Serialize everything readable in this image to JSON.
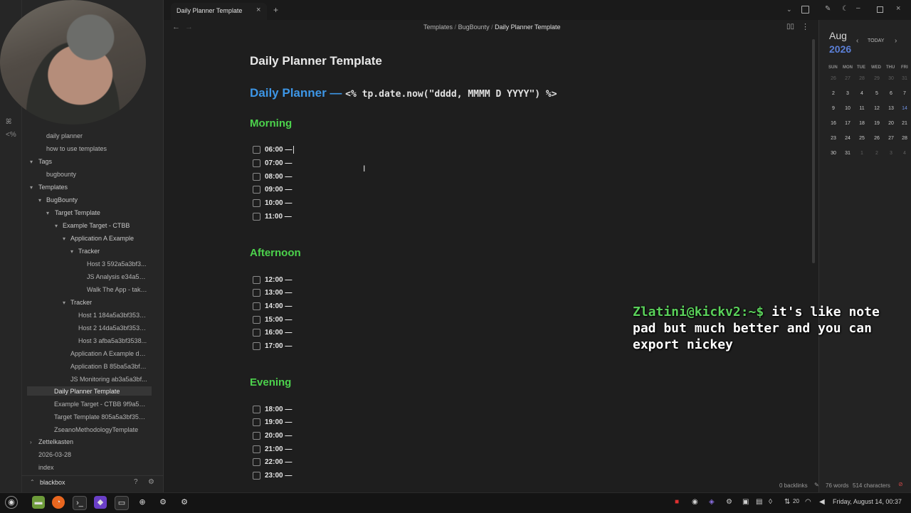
{
  "tab": {
    "title": "Daily Planner Template",
    "close": "×",
    "new": "+"
  },
  "breadcrumb": {
    "part1": "Templates",
    "sep": "/",
    "part2": "BugBounty",
    "part3": "Daily Planner Template"
  },
  "note": {
    "title": "Daily Planner Template",
    "heading_text": "Daily Planner — ",
    "heading_code": "<% tp.date.now(\"dddd, MMMM D YYYY\") %>",
    "sections": {
      "morning": "Morning",
      "afternoon": "Afternoon",
      "evening": "Evening"
    },
    "morning_tasks": [
      "06:00 —",
      "07:00 —",
      "08:00 —",
      "09:00 —",
      "10:00 —",
      "11:00 —"
    ],
    "afternoon_tasks": [
      "12:00 —",
      "13:00 —",
      "14:00 —",
      "15:00 —",
      "16:00 —",
      "17:00 —"
    ],
    "evening_tasks": [
      "18:00 —",
      "19:00 —",
      "20:00 —",
      "21:00 —",
      "22:00 —",
      "23:00 —"
    ]
  },
  "sidebar": {
    "items": [
      "daily planner",
      "how to use templates",
      "Tags",
      "bugbounty",
      "Templates",
      "BugBounty",
      "Target Template",
      "Example Target - CTBB",
      "Application A Example",
      "Tracker",
      "Host 3 592a5a3bf3...",
      "JS Analysis e34a5a...",
      "Walk The App - take...",
      "Tracker",
      "Host 1 184a5a3bf3538...",
      "Host 2 14da5a3bf3538...",
      "Host 3 afba5a3bf3538...",
      "Application A Example de...",
      "Application B 85ba5a3bf3...",
      "JS Monitoring ab3a5a3bf...",
      "Daily Planner Template",
      "Example Target - CTBB 9f9a5a...",
      "Target Template 805a5a3bf353...",
      "ZseanoMethodologyTemplate",
      "Zettelkasten",
      "2026-03-28",
      "index"
    ],
    "vault_name": "blackbox",
    "ribbon_icons": [
      "ꕤ",
      "<%"
    ]
  },
  "calendar": {
    "month": "Aug",
    "year": "2026",
    "today_button": "TODAY",
    "weekdays": [
      "SUN",
      "MON",
      "TUE",
      "WED",
      "THU",
      "FRI"
    ],
    "rows": [
      [
        "26",
        "27",
        "28",
        "29",
        "30",
        "31"
      ],
      [
        "2",
        "3",
        "4",
        "5",
        "6",
        "7"
      ],
      [
        "9",
        "10",
        "11",
        "12",
        "13",
        "14"
      ],
      [
        "16",
        "17",
        "18",
        "19",
        "20",
        "21"
      ],
      [
        "23",
        "24",
        "25",
        "26",
        "27",
        "28"
      ],
      [
        "30",
        "31",
        "1",
        "2",
        "3",
        "4"
      ]
    ]
  },
  "overlay": {
    "prompt": "Zlatini@kickv2:~$",
    "message": " it's like note pad but much better and you can export nickey"
  },
  "status": {
    "backlinks": "0 backlinks",
    "words": "76 words",
    "chars": "514 characters"
  },
  "taskbar": {
    "wifi_label": "20",
    "datetime": "Friday, August 14, 00:37"
  }
}
